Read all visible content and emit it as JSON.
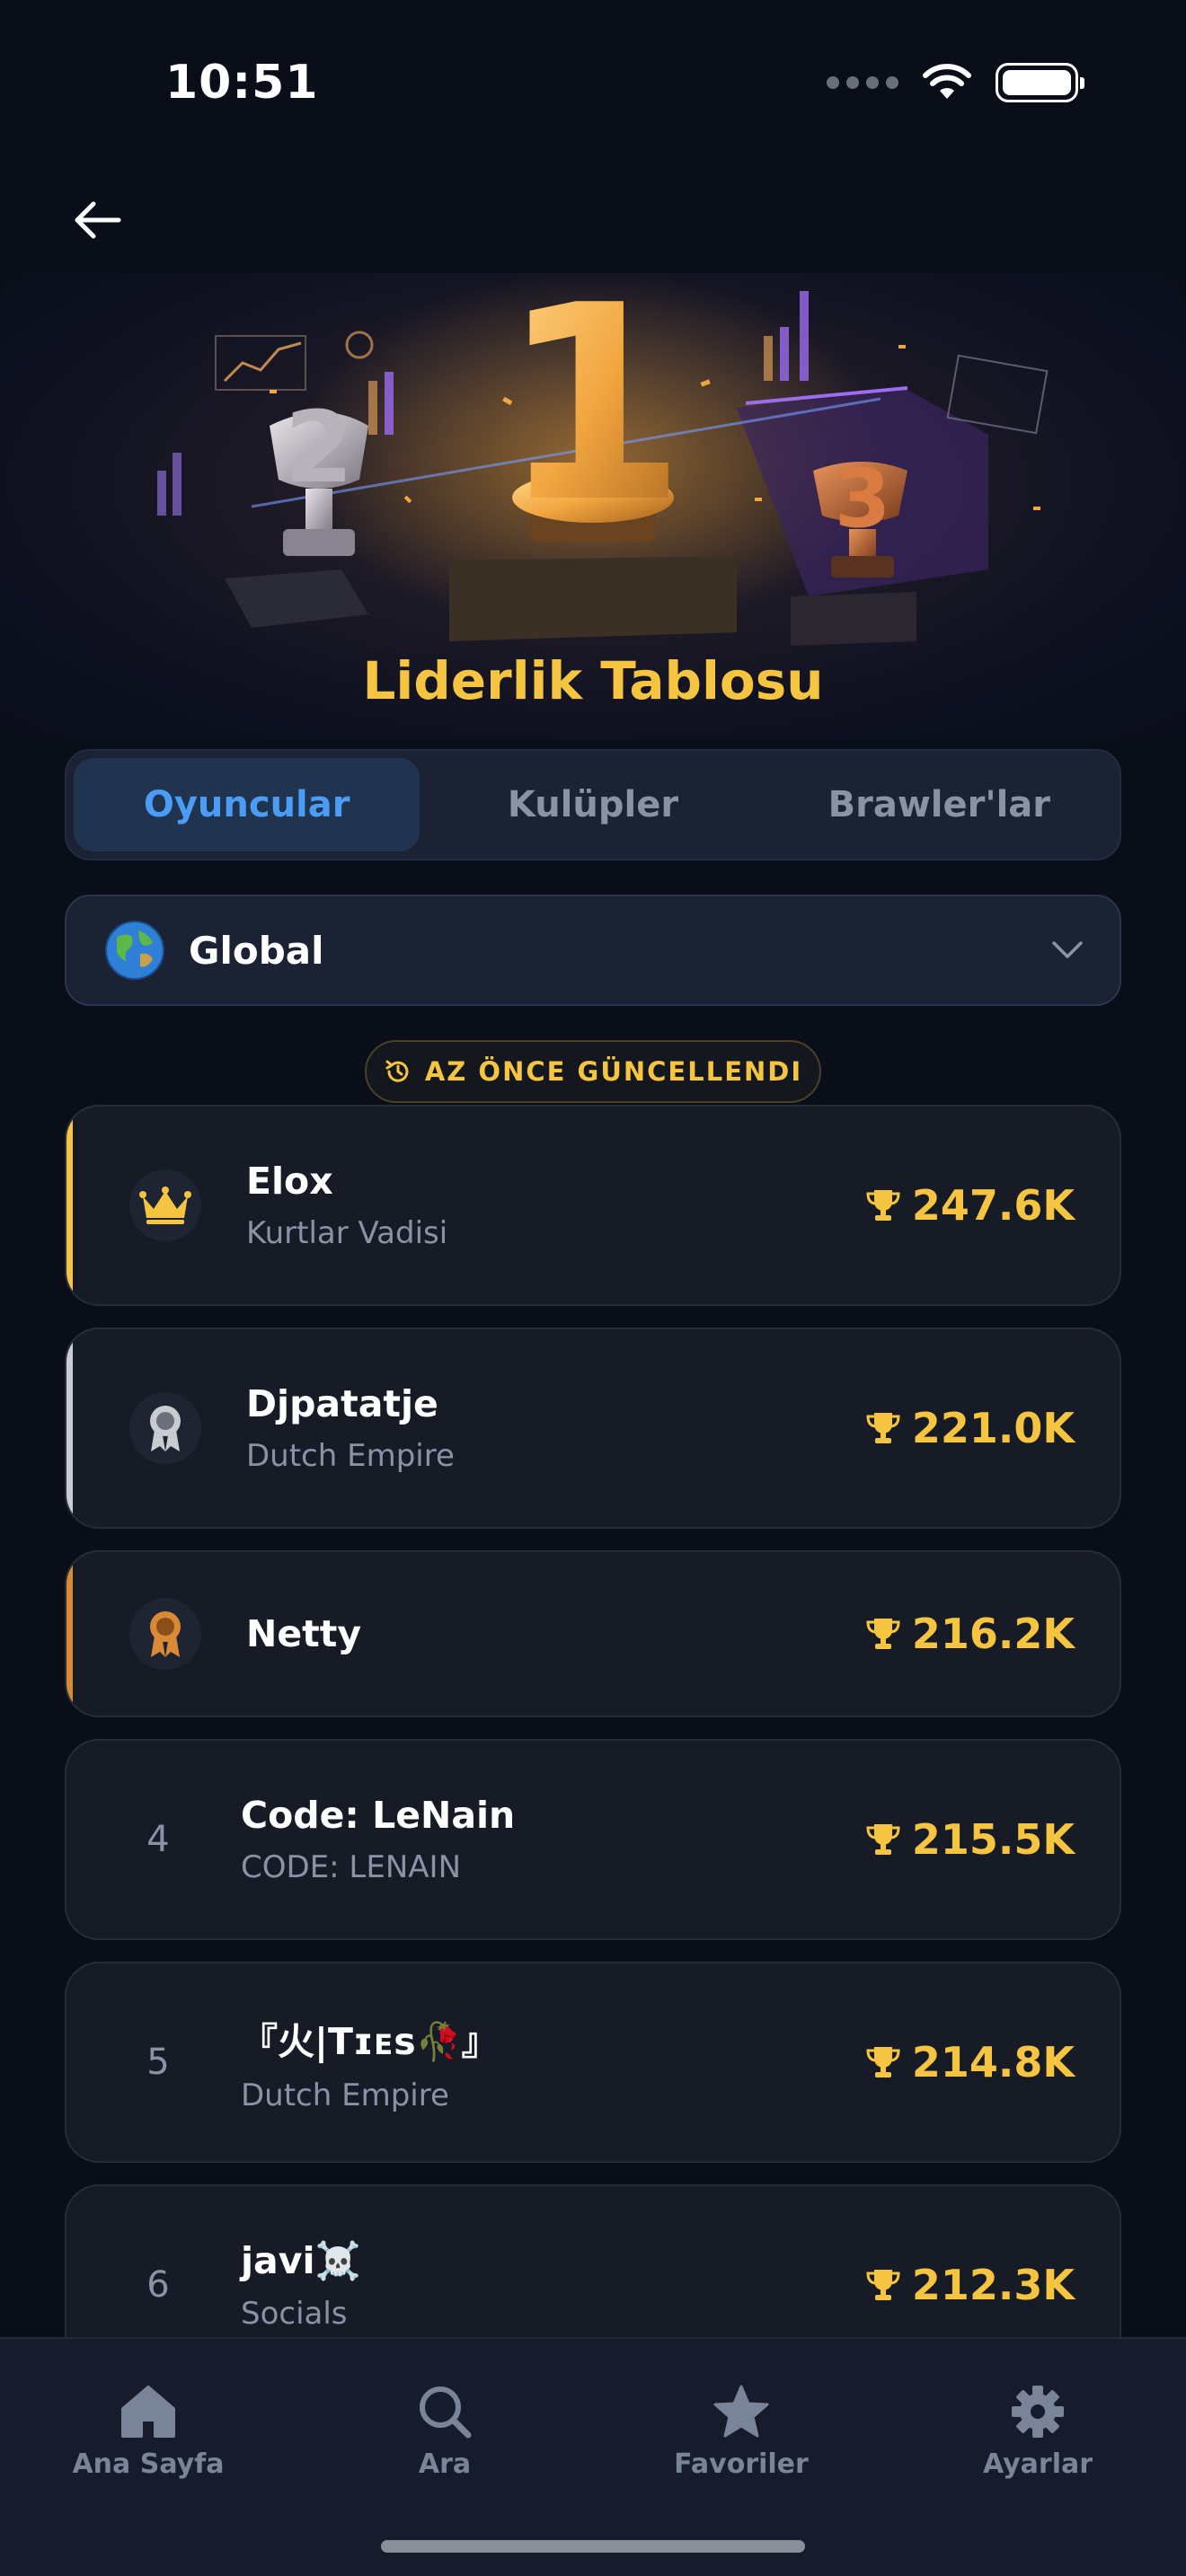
{
  "status_bar": {
    "time": "10:51"
  },
  "header": {
    "title": "Liderlik Tablosu"
  },
  "tabs": [
    {
      "label": "Oyuncular",
      "active": true
    },
    {
      "label": "Kulüpler",
      "active": false
    },
    {
      "label": "Brawler'lar",
      "active": false
    }
  ],
  "region": {
    "label": "Global",
    "icon": "globe-icon"
  },
  "updated_badge": {
    "label": "AZ ÖNCE GÜNCELLENDI",
    "icon": "history-icon"
  },
  "rankings": [
    {
      "rank": "1",
      "icon": "crown-icon",
      "name": "Elox",
      "club": "Kurtlar Vadisi",
      "score": "247.6K",
      "accent": "#f5c542"
    },
    {
      "rank": "2",
      "icon": "silver-medal-icon",
      "name": "Djpatatje",
      "club": "Dutch Empire",
      "score": "221.0K",
      "accent": "#c9ccd3"
    },
    {
      "rank": "3",
      "icon": "bronze-medal-icon",
      "name": "Netty",
      "club": "",
      "score": "216.2K",
      "accent": "#d98a34"
    },
    {
      "rank": "4",
      "name": "Code: LeNain",
      "club": "CODE: LENAIN",
      "score": "215.5K"
    },
    {
      "rank": "5",
      "name": "『火|Tɪᴇs🥀』",
      "club": "Dutch Empire",
      "score": "214.8K"
    },
    {
      "rank": "6",
      "name": "javi☠️",
      "club": "Socials",
      "score": "212.3K"
    }
  ],
  "bottom_nav": [
    {
      "label": "Ana Sayfa",
      "icon": "home-icon"
    },
    {
      "label": "Ara",
      "icon": "search-icon"
    },
    {
      "label": "Favoriler",
      "icon": "star-icon"
    },
    {
      "label": "Ayarlar",
      "icon": "gear-icon"
    }
  ],
  "colors": {
    "background": "#0a0e19",
    "accent_gold": "#f5c542",
    "tab_active": "#4b9cf5",
    "card": "#171b26"
  }
}
